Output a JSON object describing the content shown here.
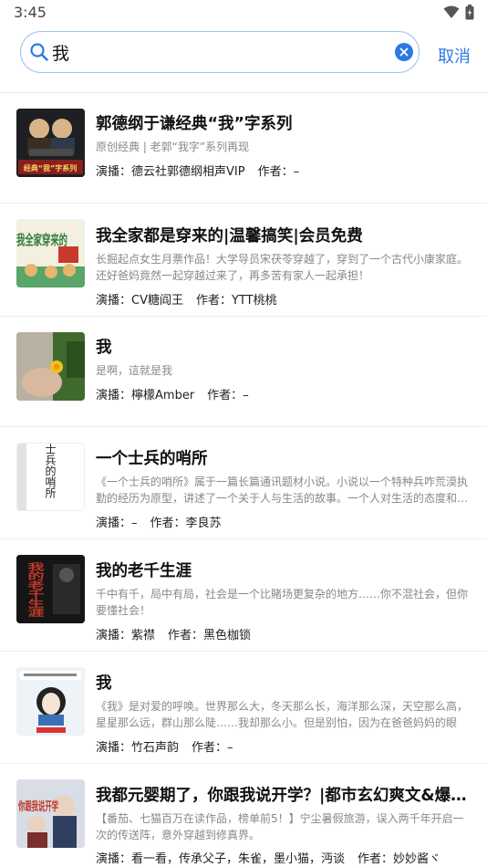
{
  "status": {
    "time": "3:45"
  },
  "search": {
    "query": "我",
    "cancel_label": "取消"
  },
  "labels": {
    "narrator": "演播：",
    "author": "作者："
  },
  "results": [
    {
      "title": "郭德纲于谦经典“我”字系列",
      "desc": "原创经典 | 老郭“我字”系列再现",
      "narrator": "德云社郭德纲相声VIP",
      "author": "–",
      "cover_text": "经典“我”字系列"
    },
    {
      "title": "我全家都是穿来的|温馨搞笑|会员免费",
      "desc": "长掘起点女生月票作品！大学导员宋茯苓穿越了，穿到了一个古代小康家庭。还好爸妈竟然一起穿越过来了，再多苦有家人一起承担！",
      "narrator": "CV糖阎王",
      "author": "YTT桃桃",
      "cover_text": "我全家穿来的"
    },
    {
      "title": "我",
      "desc": "是啊，這就是我",
      "narrator": "檸檬Amber",
      "author": "–",
      "cover_text": ""
    },
    {
      "title": "一个士兵的哨所",
      "desc": "《一个士兵的哨所》属于一篇长篇通讯题材小说。小说以一个特种兵咋荒漠执勤的经历为原型，讲述了一个关于人与生活的故事。一个人对生活的态度和…",
      "narrator": "–",
      "author": "李良苏",
      "cover_text": "一个士兵的哨所"
    },
    {
      "title": "我的老千生涯",
      "desc": " 千中有千，局中有局，社会是一个比賭场更复杂的地方……你不混社会，但你要懂社会！",
      "narrator": "紫襟",
      "author": "黑色枷锁",
      "cover_text": "我的老千生涯"
    },
    {
      "title": "我",
      "desc": "《我》是对爱的呼唤。世界那么大，冬天那么长，海洋那么深，天空那么高，星星那么远，群山那么陡……我却那么小。但是别怕，因为在爸爸妈妈的眼中…",
      "narrator": "竹石声韵",
      "author": "–",
      "cover_text": ""
    },
    {
      "title": "我都元婴期了，你跟我说开学？|都市玄幻爽文&爆…",
      "desc": "【番茄、七猫百万在读作品，榜单前5！】宁尘暑假旅游，误入两千年开启一次的传送阵，意外穿越到修真界。",
      "narrator": "看一看，传承父子，朱雀，墨小猫，沔谈",
      "author": "妙妙酱ヾ",
      "cover_text": "你跟我说开学"
    }
  ],
  "colors": {
    "accent": "#2a7ae2",
    "search_border": "#9cc4ee"
  }
}
